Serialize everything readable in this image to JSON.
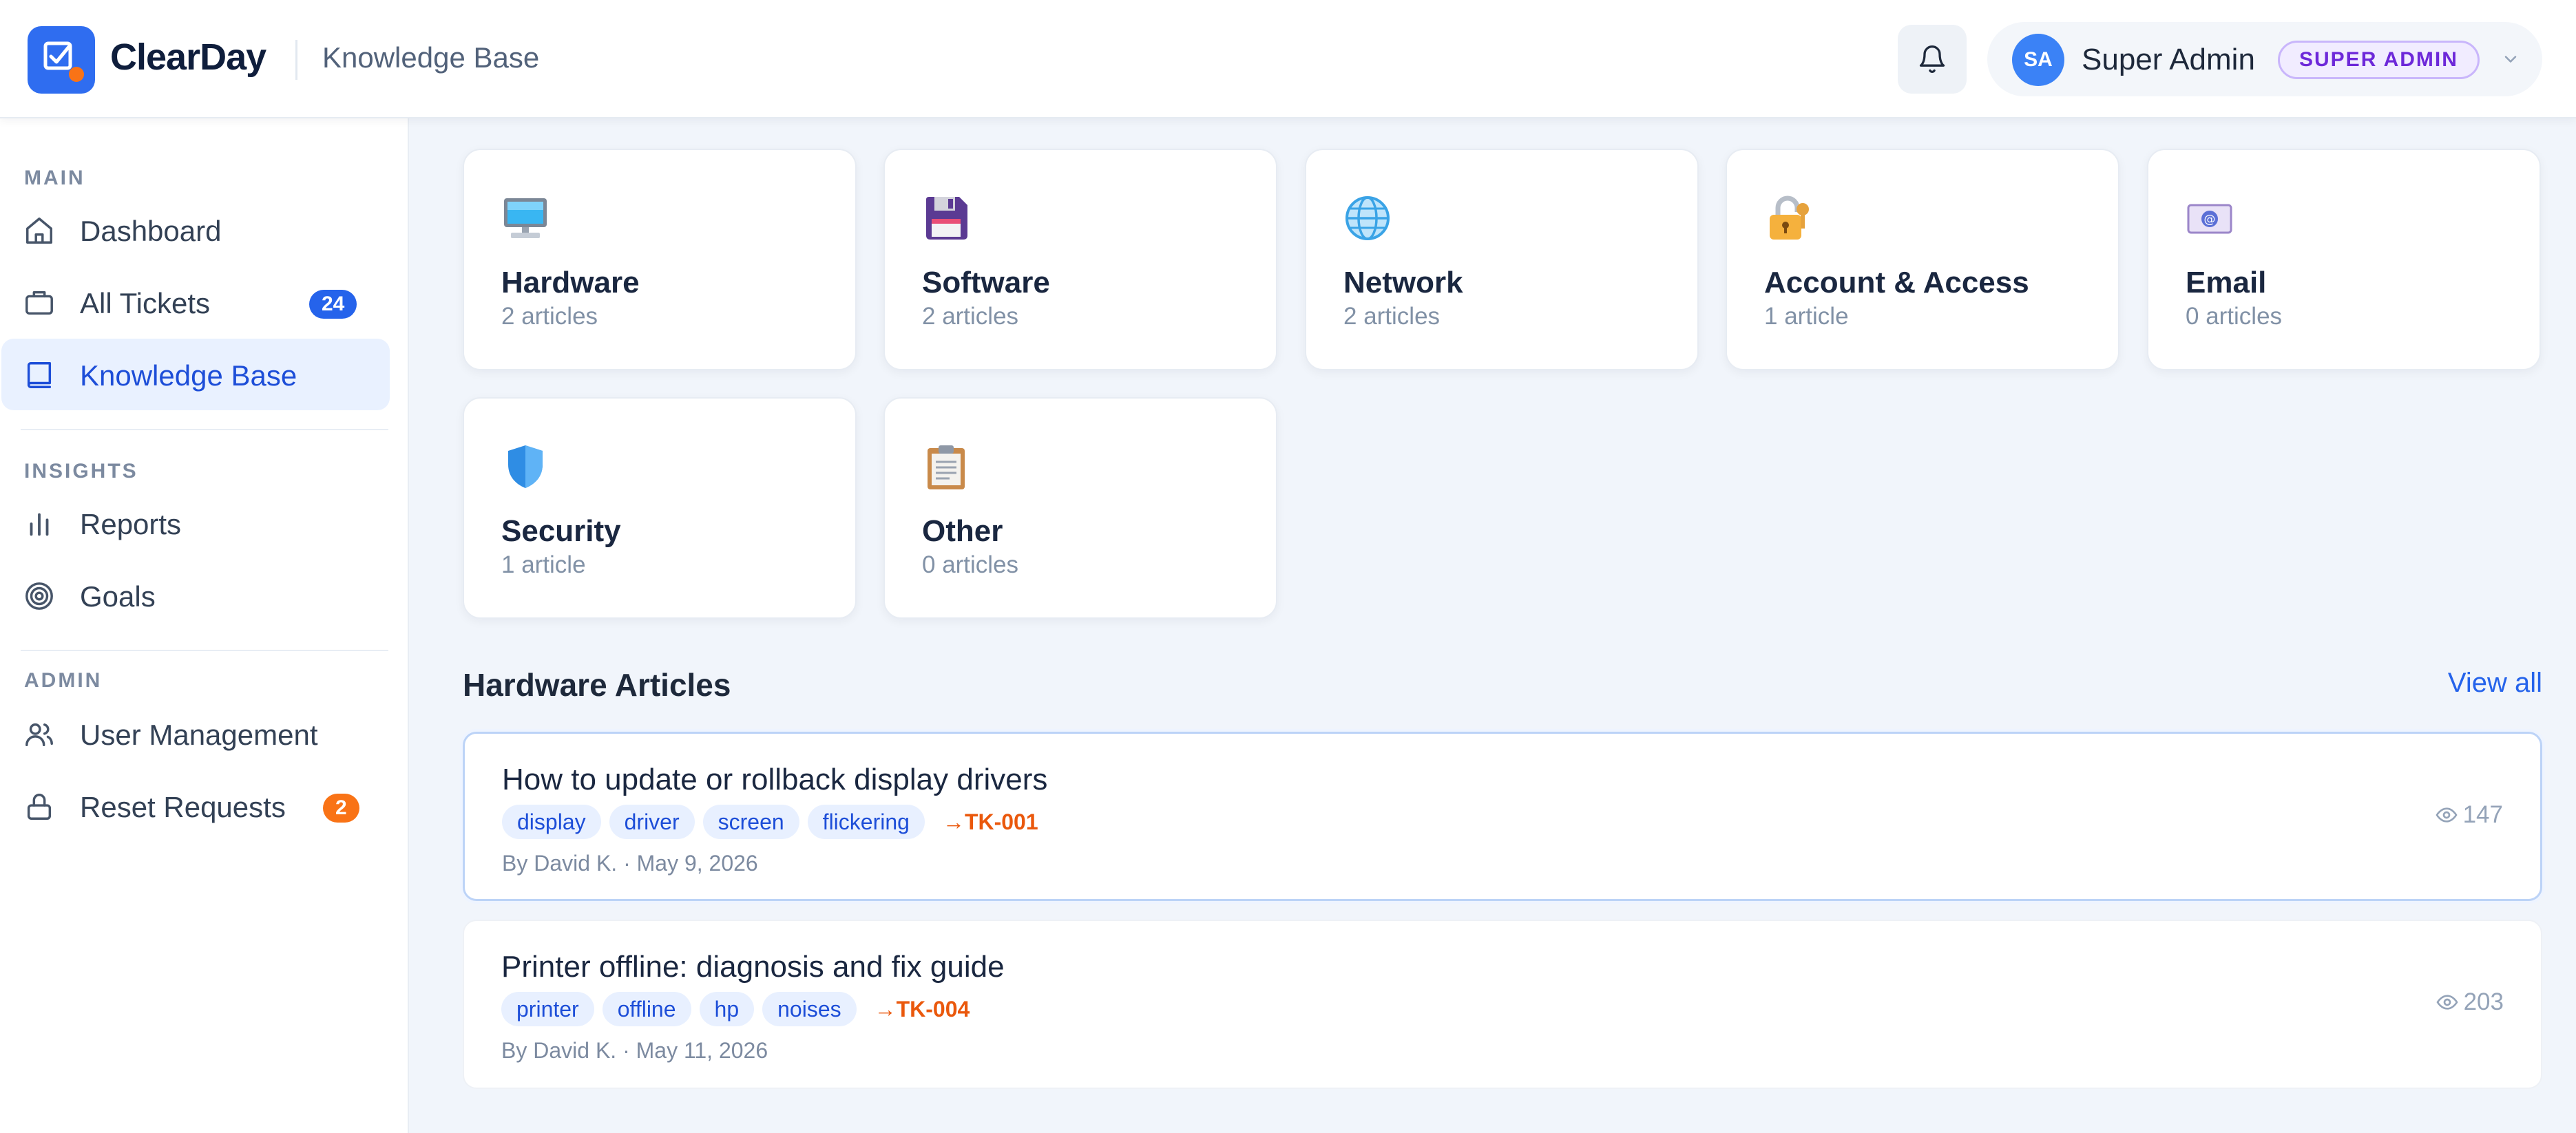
{
  "app": {
    "brand": "ClearDay",
    "page": "Knowledge Base"
  },
  "user": {
    "initials": "SA",
    "name": "Super Admin",
    "role": "SUPER ADMIN"
  },
  "sidebar": {
    "sections": [
      {
        "label": "MAIN",
        "items": [
          {
            "label": "Dashboard",
            "icon": "home-icon"
          },
          {
            "label": "All Tickets",
            "icon": "ticket-icon",
            "badge": "24"
          },
          {
            "label": "Knowledge Base",
            "icon": "book-icon",
            "active": true
          }
        ]
      },
      {
        "label": "INSIGHTS",
        "items": [
          {
            "label": "Reports",
            "icon": "bar-chart-icon"
          },
          {
            "label": "Goals",
            "icon": "target-icon"
          }
        ]
      },
      {
        "label": "ADMIN",
        "items": [
          {
            "label": "User Management",
            "icon": "users-icon"
          },
          {
            "label": "Reset Requests",
            "icon": "lock-icon",
            "badge": "2"
          }
        ]
      }
    ]
  },
  "categories": [
    {
      "title": "Hardware",
      "count": "2 articles",
      "icon": "computer-icon"
    },
    {
      "title": "Software",
      "count": "2 articles",
      "icon": "floppy-disk-icon"
    },
    {
      "title": "Network",
      "count": "2 articles",
      "icon": "globe-icon"
    },
    {
      "title": "Account & Access",
      "count": "1 article",
      "icon": "padlock-icon"
    },
    {
      "title": "Email",
      "count": "0 articles",
      "icon": "envelope-icon"
    },
    {
      "title": "Security",
      "count": "1 article",
      "icon": "shield-icon"
    },
    {
      "title": "Other",
      "count": "0 articles",
      "icon": "clipboard-icon"
    }
  ],
  "articles_section": {
    "title": "Hardware Articles",
    "view_all": "View all"
  },
  "articles": [
    {
      "title": "How to update or rollback display drivers",
      "tags": [
        "display",
        "driver",
        "screen",
        "flickering"
      ],
      "ticket": "→TK-001",
      "meta": "By David K. · May 9, 2026",
      "views": "147"
    },
    {
      "title": "Printer offline: diagnosis and fix guide",
      "tags": [
        "printer",
        "offline",
        "hp",
        "noises"
      ],
      "ticket": "→TK-004",
      "meta": "By David K. · May 11, 2026",
      "views": "203"
    }
  ],
  "colors": {
    "accent": "#2f6df0",
    "badge_blue": "#2563eb",
    "badge_orange": "#f97316",
    "ticket_link": "#ea580c",
    "role_purple": "#6d28d9"
  }
}
